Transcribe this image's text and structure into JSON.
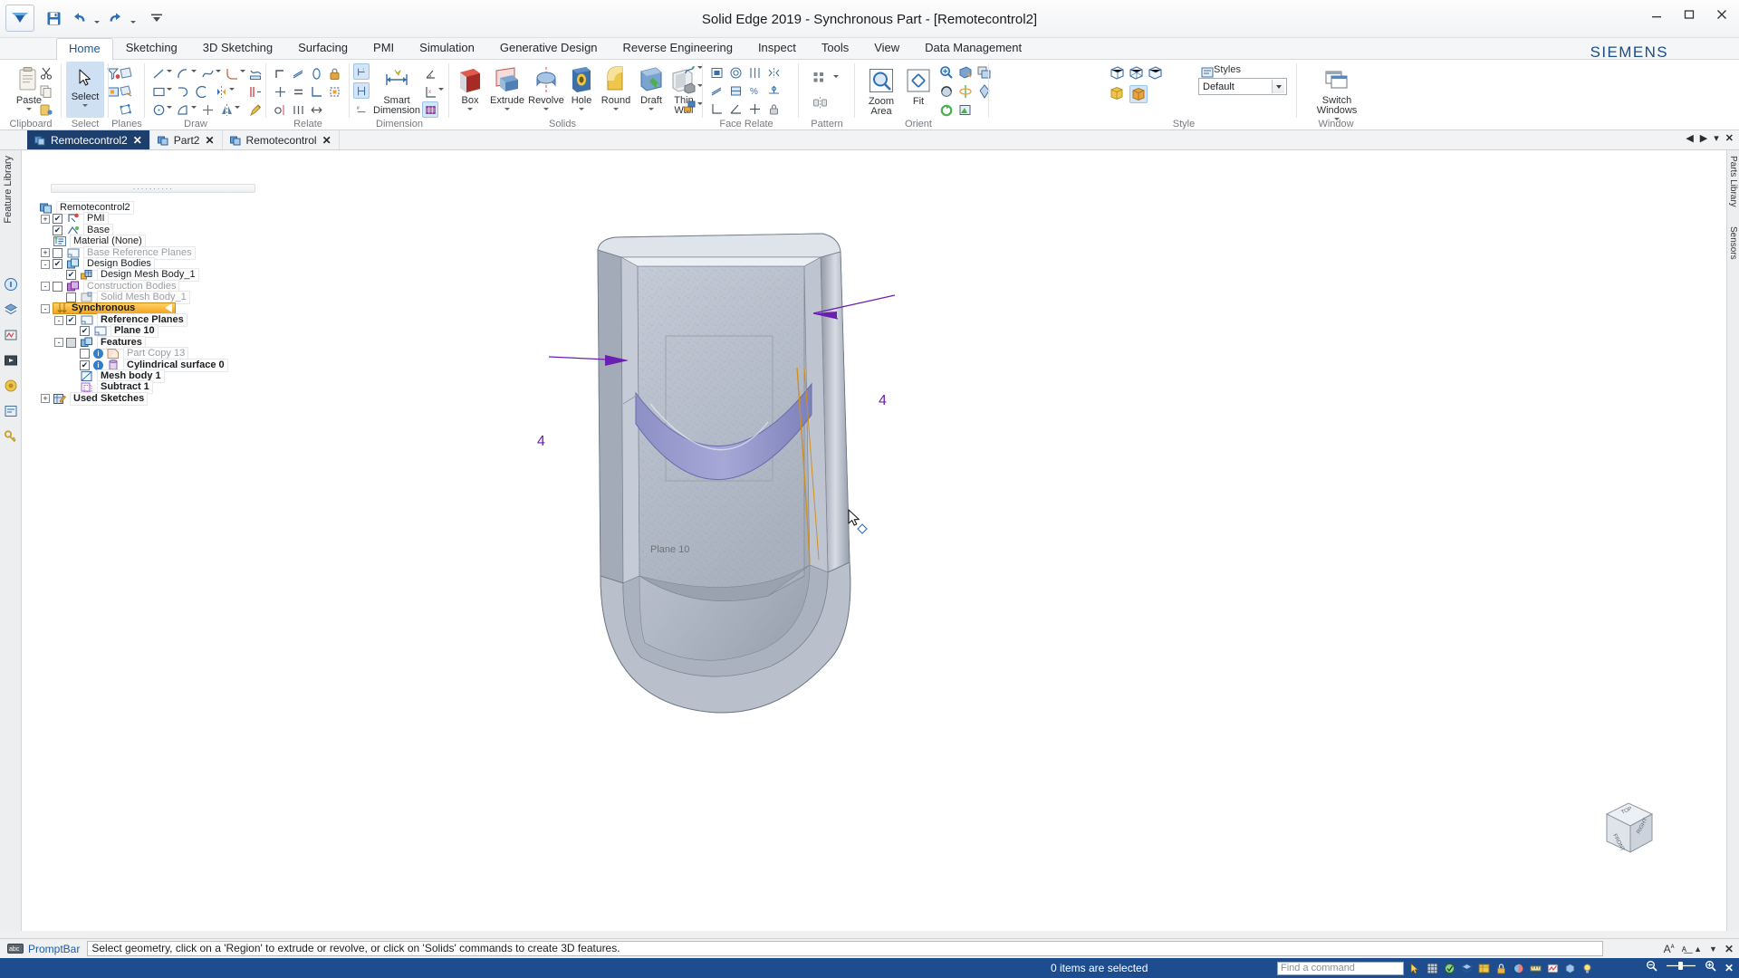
{
  "window": {
    "title": "Solid Edge 2019 - Synchronous Part - [Remotecontrol2]",
    "brand": "SIEMENS",
    "minimize": "–",
    "maximize": "□",
    "close": "✕"
  },
  "quick_access": {
    "items": [
      {
        "name": "save-icon",
        "label": "Save"
      },
      {
        "name": "undo-icon",
        "label": "Undo"
      },
      {
        "name": "redo-icon",
        "label": "Redo"
      },
      {
        "name": "customize-qat-icon",
        "label": "Customize Quick Access Toolbar"
      }
    ]
  },
  "ribbon": {
    "tabs": [
      {
        "label": "Home",
        "active": true
      },
      {
        "label": "Sketching",
        "active": false
      },
      {
        "label": "3D Sketching",
        "active": false
      },
      {
        "label": "Surfacing",
        "active": false
      },
      {
        "label": "PMI",
        "active": false
      },
      {
        "label": "Simulation",
        "active": false
      },
      {
        "label": "Generative Design",
        "active": false
      },
      {
        "label": "Reverse Engineering",
        "active": false
      },
      {
        "label": "Inspect",
        "active": false
      },
      {
        "label": "Tools",
        "active": false
      },
      {
        "label": "View",
        "active": false
      },
      {
        "label": "Data Management",
        "active": false
      }
    ],
    "groups": [
      {
        "label": "Clipboard"
      },
      {
        "label": "Select"
      },
      {
        "label": "Planes"
      },
      {
        "label": "Draw"
      },
      {
        "label": "Relate"
      },
      {
        "label": "Dimension"
      },
      {
        "label": "Solids"
      },
      {
        "label": "Face Relate"
      },
      {
        "label": "Pattern"
      },
      {
        "label": "Orient"
      },
      {
        "label": "Style"
      },
      {
        "label": "Window"
      }
    ],
    "buttons": {
      "paste": "Paste",
      "select": "Select",
      "smart_dimension_l1": "Smart",
      "smart_dimension_l2": "Dimension",
      "box": "Box",
      "extrude": "Extrude",
      "revolve": "Revolve",
      "hole": "Hole",
      "round": "Round",
      "draft": "Draft",
      "thin_wall_l1": "Thin",
      "thin_wall_l2": "Wall",
      "zoom_area_l1": "Zoom",
      "zoom_area_l2": "Area",
      "fit": "Fit",
      "switch_windows_l1": "Switch",
      "switch_windows_l2": "Windows"
    },
    "style": {
      "styles_label": "Styles",
      "selected_style": "Default"
    }
  },
  "document_tabs": {
    "items": [
      {
        "label": "Remotecontrol2",
        "active": true,
        "closable": true
      },
      {
        "label": "Part2",
        "active": false,
        "closable": true
      },
      {
        "label": "Remotecontrol",
        "active": false,
        "closable": true
      }
    ],
    "close_all": "✕"
  },
  "left_dock": {
    "items": [
      {
        "label": "Feature Library",
        "name": "feature-library"
      }
    ]
  },
  "right_dock": {
    "items": [
      {
        "label": "Parts Library",
        "name": "parts-library"
      },
      {
        "label": "Sensors",
        "name": "sensors"
      }
    ]
  },
  "feature_tree": {
    "nodes": [
      {
        "label": "Remotecontrol2",
        "indent": 0,
        "expander": "",
        "check": "none",
        "icon": "part-icon",
        "bold": false,
        "dim": false
      },
      {
        "label": "PMI",
        "indent": 1,
        "expander": "+",
        "check": "on",
        "icon": "pmi-icon",
        "bold": false,
        "dim": false
      },
      {
        "label": "Base",
        "indent": 1,
        "expander": "",
        "check": "on",
        "icon": "base-icon",
        "bold": false,
        "dim": false
      },
      {
        "label": "Material (None)",
        "indent": 1,
        "expander": "",
        "check": "none",
        "icon": "material-icon",
        "bold": false,
        "dim": false
      },
      {
        "label": "Base Reference Planes",
        "indent": 1,
        "expander": "+",
        "check": "off",
        "icon": "plane-icon",
        "bold": false,
        "dim": true
      },
      {
        "label": "Design Bodies",
        "indent": 1,
        "expander": "-",
        "check": "on",
        "icon": "bodies-icon",
        "bold": false,
        "dim": false
      },
      {
        "label": "Design Mesh Body_1",
        "indent": 2,
        "expander": "",
        "check": "on",
        "icon": "mesh-body-icon",
        "bold": false,
        "dim": false
      },
      {
        "label": "Construction Bodies",
        "indent": 1,
        "expander": "-",
        "check": "off",
        "icon": "construction-icon",
        "bold": false,
        "dim": true
      },
      {
        "label": "Solid Mesh Body_1",
        "indent": 2,
        "expander": "",
        "check": "off",
        "icon": "solid-mesh-icon",
        "bold": false,
        "dim": true
      },
      {
        "label": "Synchronous",
        "indent": 1,
        "expander": "-",
        "check": "none",
        "icon": "synchronous-icon",
        "bold": true,
        "dim": false,
        "highlight": true
      },
      {
        "label": "Reference Planes",
        "indent": 2,
        "expander": "-",
        "check": "on",
        "icon": "plane-icon",
        "bold": true,
        "dim": false
      },
      {
        "label": "Plane 10",
        "indent": 3,
        "expander": "",
        "check": "on",
        "icon": "plane-icon",
        "bold": true,
        "dim": false
      },
      {
        "label": "Features",
        "indent": 2,
        "expander": "-",
        "check": "gray",
        "icon": "features-icon",
        "bold": true,
        "dim": false
      },
      {
        "label": "Part Copy 13",
        "indent": 3,
        "expander": "",
        "check": "off",
        "icon": "part-copy-icon",
        "bold": false,
        "dim": true,
        "info": true
      },
      {
        "label": "Cylindrical surface 0",
        "indent": 3,
        "expander": "",
        "check": "on",
        "icon": "cylindrical-surface-icon",
        "bold": true,
        "dim": false,
        "info": true
      },
      {
        "label": "Mesh body 1",
        "indent": 3,
        "expander": "",
        "check": "none",
        "icon": "mesh-body-feature-icon",
        "bold": true,
        "dim": false
      },
      {
        "label": "Subtract 1",
        "indent": 3,
        "expander": "",
        "check": "none",
        "icon": "subtract-icon",
        "bold": true,
        "dim": false
      },
      {
        "label": "Used Sketches",
        "indent": 1,
        "expander": "+",
        "check": "none",
        "icon": "used-sketches-icon",
        "bold": true,
        "dim": false
      }
    ]
  },
  "viewport": {
    "dimension_left": "4",
    "dimension_right": "4",
    "plane_label": "Plane 10",
    "viewcube": {
      "top": "TOP",
      "front": "FRONT",
      "right": "RIGHT"
    },
    "colors": {
      "body_light": "#c2c8d4",
      "body_mid": "#aab2c0",
      "body_dark": "#8d94a3",
      "highlight_band": "#8b8fc4",
      "dimension": "#6b1fb0",
      "edge_orange": "#d09020"
    }
  },
  "prompt_bar": {
    "label": "PromptBar",
    "message": "Select geometry, click on a 'Region' to extrude or revolve, or click on 'Solids' commands to create 3D features.",
    "right_icons": [
      "text-style-icon",
      "text-size-icon",
      "chevron-up-icon",
      "chevron-down-icon",
      "close-icon"
    ]
  },
  "status_bar": {
    "selection": "0 items are selected",
    "find_placeholder": "Find a command",
    "icons": [
      "select-tool-icon",
      "grid-icon",
      "snap-icon",
      "layer-icon",
      "material-table-icon",
      "lock-icon",
      "color-icon",
      "measure-icon",
      "sensor-icon",
      "view-icon",
      "light-icon"
    ],
    "right_icons": [
      "zoom-out-icon",
      "zoom-slider-icon",
      "zoom-in-icon",
      "close-icon"
    ]
  }
}
